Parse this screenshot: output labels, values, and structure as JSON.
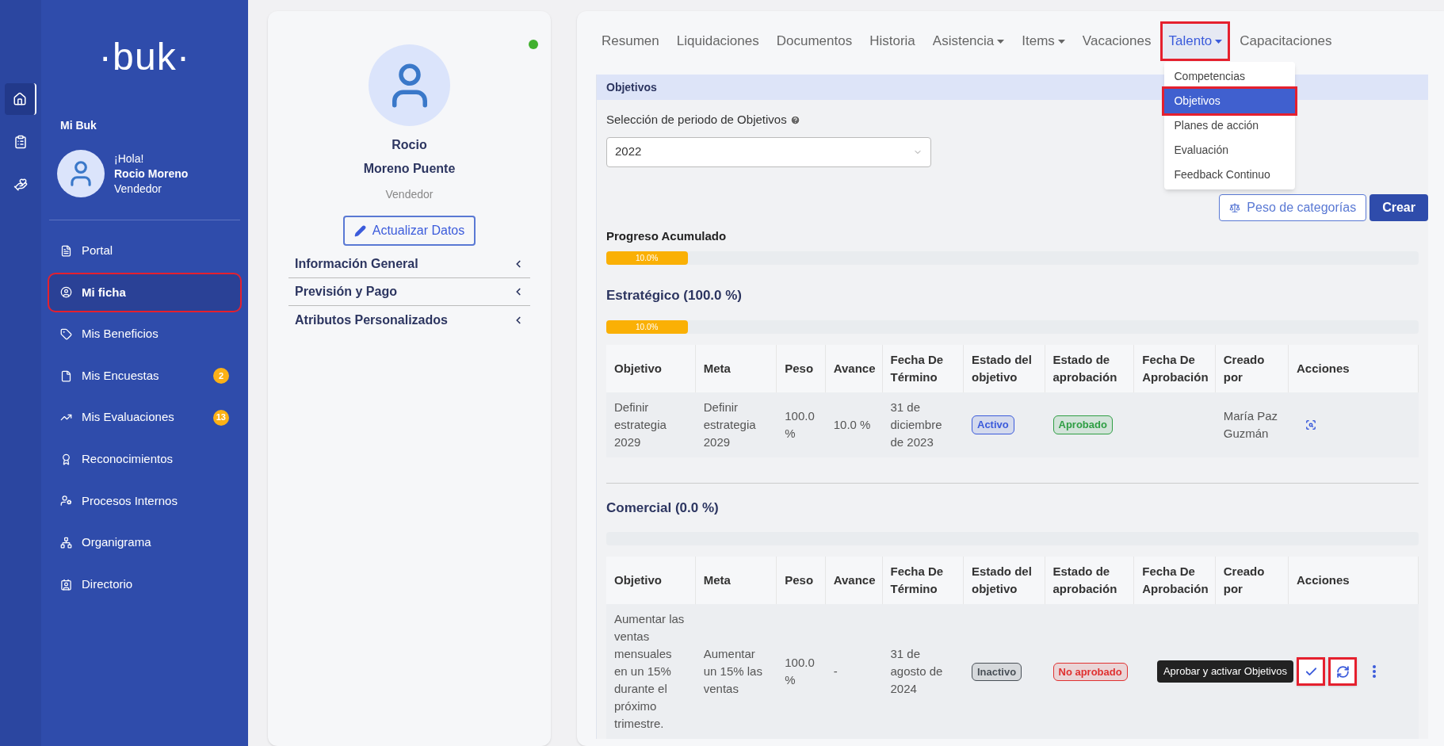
{
  "rail": [
    {
      "kind": "home",
      "selected": true
    },
    {
      "kind": "clipboard",
      "selected": false
    },
    {
      "kind": "hand",
      "selected": false
    }
  ],
  "sidebar": {
    "logo": "·buk·",
    "section": "Mi Buk",
    "user": {
      "greeting": "¡Hola!",
      "name": "Rocio Moreno",
      "role": "Vendedor"
    },
    "items": [
      {
        "kind": "portal",
        "label": "Portal",
        "selected": false,
        "highlighted": false
      },
      {
        "kind": "profile",
        "label": "Mi ficha",
        "selected": true,
        "highlighted": true
      },
      {
        "kind": "tag",
        "label": "Mis Beneficios",
        "selected": false,
        "highlighted": false
      },
      {
        "kind": "doc",
        "label": "Mis Encuestas",
        "badge": "2",
        "selected": false,
        "highlighted": false
      },
      {
        "kind": "trend",
        "label": "Mis Evaluaciones",
        "badge": "13",
        "selected": false,
        "highlighted": false
      },
      {
        "kind": "award",
        "label": "Reconocimientos",
        "selected": false,
        "highlighted": false
      },
      {
        "kind": "process",
        "label": "Procesos Internos",
        "selected": false,
        "highlighted": false
      },
      {
        "kind": "org",
        "label": "Organigrama",
        "selected": false,
        "highlighted": false
      },
      {
        "kind": "contact",
        "label": "Directorio",
        "selected": false,
        "highlighted": false
      }
    ]
  },
  "profile": {
    "online": true,
    "first_name": "Rocio",
    "last_name": "Moreno Puente",
    "role": "Vendedor",
    "button": "Actualizar Datos",
    "sections": [
      {
        "label": "Información General",
        "expanded": false
      },
      {
        "label": "Previsión y Pago",
        "expanded": false
      },
      {
        "label": "Atributos Personalizados",
        "expanded": false
      }
    ]
  },
  "tabs": [
    {
      "label": "Resumen",
      "selected": false,
      "dropdown": false,
      "highlighted": false
    },
    {
      "label": "Liquidaciones",
      "selected": false,
      "dropdown": false,
      "highlighted": false
    },
    {
      "label": "Documentos",
      "selected": false,
      "dropdown": false,
      "highlighted": false
    },
    {
      "label": "Historia",
      "selected": false,
      "dropdown": false,
      "highlighted": false
    },
    {
      "label": "Asistencia",
      "selected": false,
      "dropdown": true,
      "highlighted": false
    },
    {
      "label": "Items",
      "selected": false,
      "dropdown": true,
      "highlighted": false
    },
    {
      "label": "Vacaciones",
      "selected": false,
      "dropdown": false,
      "highlighted": false
    },
    {
      "label": "Talento",
      "selected": true,
      "dropdown": true,
      "highlighted": true,
      "menu": [
        {
          "label": "Competencias",
          "selected": false,
          "highlighted": false
        },
        {
          "label": "Objetivos",
          "selected": true,
          "highlighted": true
        },
        {
          "label": "Planes de acción",
          "selected": false,
          "highlighted": false
        },
        {
          "label": "Evaluación",
          "selected": false,
          "highlighted": false
        },
        {
          "label": "Feedback Continuo",
          "selected": false,
          "highlighted": false
        }
      ]
    },
    {
      "label": "Capacitaciones",
      "selected": false,
      "dropdown": false,
      "highlighted": false
    }
  ],
  "panel": {
    "title": "Objetivos",
    "period_label": "Selección de periodo de Objetivos",
    "period_value": "2022",
    "buttons": [
      {
        "kind": "outline",
        "label": "Peso de categorías"
      },
      {
        "kind": "primary",
        "label": "Crear"
      }
    ],
    "progress": {
      "label": "Progreso Acumulado",
      "level": 0.1,
      "reading": "10.0%"
    },
    "categories": [
      {
        "title": "Estratégico (100.0 %)",
        "level": 0.1,
        "reading": "10.0%",
        "columns": [
          "Objetivo",
          "Meta",
          "Peso",
          "Avance",
          "Fecha De Término",
          "Estado del objetivo",
          "Estado de aprobación",
          "Fecha De Aprobación",
          "Creado por",
          "Acciones"
        ],
        "rows": [
          {
            "cells": [
              {
                "kind": "text",
                "text": "Definir estrategia 2029"
              },
              {
                "kind": "text",
                "text": "Definir estrategia 2029"
              },
              {
                "kind": "text",
                "text": "100.0 %"
              },
              {
                "kind": "text",
                "text": "10.0 %"
              },
              {
                "kind": "text",
                "text": "31 de diciembre de 2023"
              },
              {
                "kind": "badge",
                "text": "Activo",
                "color": "#3b5bdb"
              },
              {
                "kind": "badge",
                "text": "Aprobado",
                "color": "#2f9e44"
              },
              {
                "kind": "covered"
              },
              {
                "kind": "text",
                "text": "María Paz Guzmán"
              },
              {
                "kind": "actions",
                "actions": [
                  {
                    "kind": "view",
                    "highlighted": false
                  }
                ]
              }
            ]
          }
        ]
      },
      {
        "title": "Comercial (0.0 %)",
        "level": 0,
        "columns": [
          "Objetivo",
          "Meta",
          "Peso",
          "Avance",
          "Fecha De Término",
          "Estado del objetivo",
          "Estado de aprobación",
          "Fecha De Aprobación",
          "Creado por",
          "Acciones"
        ],
        "rows": [
          {
            "tooltip": "Aprobar y activar Objetivos",
            "cells": [
              {
                "kind": "text",
                "text": "Aumentar las ventas mensuales en un 15% durante el próximo trimestre."
              },
              {
                "kind": "text",
                "text": "Aumentar un 15% las ventas"
              },
              {
                "kind": "text",
                "text": "100.0 %"
              },
              {
                "kind": "text",
                "text": "-"
              },
              {
                "kind": "text",
                "text": "31 de agosto de 2024"
              },
              {
                "kind": "badge",
                "text": "Inactivo",
                "color": "#495057"
              },
              {
                "kind": "badge",
                "text": "No aprobado",
                "color": "#e03131"
              },
              {
                "kind": "covered"
              },
              {
                "kind": "covered"
              },
              {
                "kind": "actions",
                "actions": [
                  {
                    "kind": "approve",
                    "highlighted": true
                  },
                  {
                    "kind": "sync",
                    "highlighted": true
                  },
                  {
                    "kind": "more",
                    "highlighted": false
                  }
                ]
              }
            ]
          }
        ]
      }
    ]
  }
}
